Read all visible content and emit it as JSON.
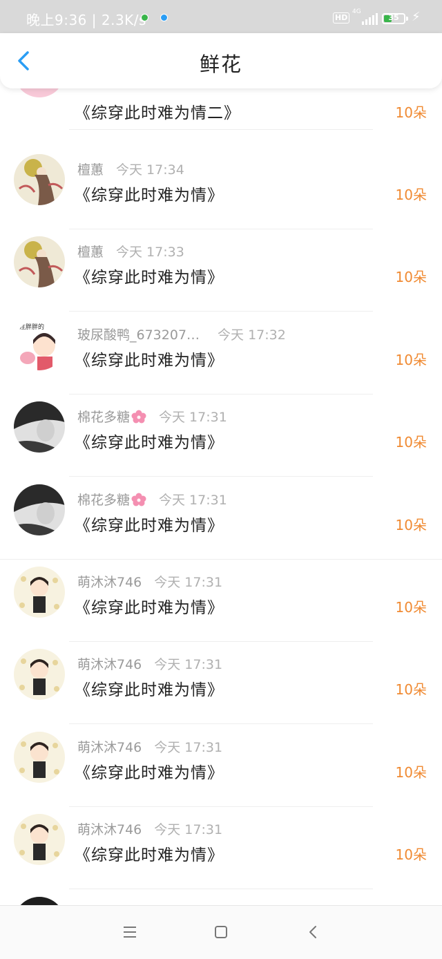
{
  "status_bar": {
    "time": "晚上9:36 | 2.3K/s",
    "hd": "HD",
    "network": "4G",
    "battery": "35",
    "battery_level": 0.35,
    "icons": [
      "wechat-dot-icon",
      "browser-dot-icon",
      "hd-icon",
      "signal-icon",
      "battery-icon",
      "charging-icon"
    ]
  },
  "header": {
    "title": "鲜花",
    "back_icon": "chevron-left-icon",
    "accent_color": "#2a9df4"
  },
  "items": [
    {
      "user": "",
      "time": "",
      "book": "《综穿此时难为情二》",
      "amount": "10朵",
      "avatar": "pink-anime-girl-avatar"
    },
    {
      "user": "檀蕙",
      "time": "今天 17:34",
      "book": "《综穿此时难为情》",
      "amount": "10朵",
      "avatar": "ancient-costume-avatar"
    },
    {
      "user": "檀蕙",
      "time": "今天 17:33",
      "book": "《综穿此时难为情》",
      "amount": "10朵",
      "avatar": "ancient-costume-avatar"
    },
    {
      "user": "玻尿酸鸭_673207…",
      "time": "今天 17:32",
      "book": "《综穿此时难为情》",
      "amount": "10朵",
      "avatar": "cartoon-girl-pig-avatar"
    },
    {
      "user": "棉花多糖",
      "time": "今天 17:31",
      "book": "《综穿此时难为情》",
      "amount": "10朵",
      "avatar": "bw-portrait-avatar",
      "emoji": "sakura-icon"
    },
    {
      "user": "棉花多糖",
      "time": "今天 17:31",
      "book": "《综穿此时难为情》",
      "amount": "10朵",
      "avatar": "bw-portrait-avatar",
      "emoji": "sakura-icon"
    },
    {
      "user": "萌沐沐746",
      "time": "今天 17:31",
      "book": "《综穿此时难为情》",
      "amount": "10朵",
      "avatar": "chibi-boy-avatar"
    },
    {
      "user": "萌沐沐746",
      "time": "今天 17:31",
      "book": "《综穿此时难为情》",
      "amount": "10朵",
      "avatar": "chibi-boy-avatar"
    },
    {
      "user": "萌沐沐746",
      "time": "今天 17:31",
      "book": "《综穿此时难为情》",
      "amount": "10朵",
      "avatar": "chibi-boy-avatar"
    },
    {
      "user": "萌沐沐746",
      "time": "今天 17:31",
      "book": "《综穿此时难为情》",
      "amount": "10朵",
      "avatar": "chibi-boy-avatar"
    }
  ],
  "colors": {
    "amount": "#f08a32",
    "username": "#9a9a9a",
    "title": "#222222"
  },
  "navbar": {
    "icons": [
      "menu-icon",
      "home-icon",
      "back-icon"
    ]
  }
}
